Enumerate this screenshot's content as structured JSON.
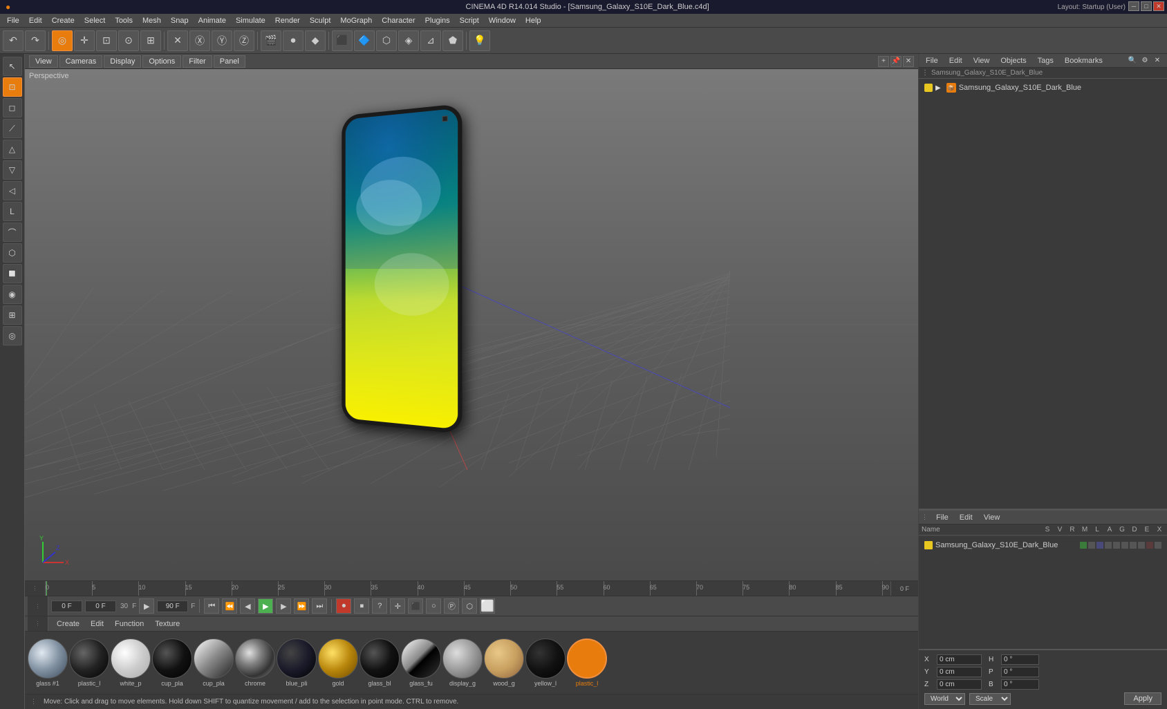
{
  "titleBar": {
    "icon": "●",
    "text": "CINEMA 4D R14.014 Studio - [Samsung_Galaxy_S10E_Dark_Blue.c4d]",
    "controls": [
      "─",
      "□",
      "✕"
    ]
  },
  "menuBar": {
    "items": [
      "File",
      "Edit",
      "Create",
      "Select",
      "Tools",
      "Mesh",
      "Snap",
      "Animate",
      "Simulate",
      "Render",
      "Sculpt",
      "MoGraph",
      "Character",
      "Plugins",
      "Script",
      "Window",
      "Help"
    ]
  },
  "viewport": {
    "tabs": [
      "View",
      "Cameras",
      "Display",
      "Options",
      "Filter",
      "Panel"
    ],
    "perspectiveLabel": "Perspective",
    "layoutLabel": "Layout: Startup (User)"
  },
  "rightPanel": {
    "topMenuItems": [
      "File",
      "Edit",
      "View",
      "Objects",
      "Tags",
      "Bookmarks"
    ],
    "objectTree": {
      "root": {
        "name": "Samsung_Galaxy_S10E_Dark_Blue",
        "icon": "📦",
        "dotColor": "#ccb800"
      }
    },
    "bottomMenuItems": [
      "File",
      "Edit",
      "View"
    ],
    "columnsHeader": [
      "Name",
      "S",
      "V",
      "R",
      "M",
      "L",
      "A",
      "G",
      "D",
      "E",
      "X"
    ],
    "sceneItems": [
      {
        "name": "Samsung_Galaxy_S10E_Dark_Blue",
        "iconType": "yellow"
      }
    ]
  },
  "timeline": {
    "startFrame": "0 F",
    "endFrame": "90 F",
    "currentFrame": "0 F",
    "nextFrame": "0 F",
    "ticks": [
      0,
      5,
      10,
      15,
      20,
      25,
      30,
      35,
      40,
      45,
      50,
      55,
      60,
      65,
      70,
      75,
      80,
      85,
      90
    ]
  },
  "transport": {
    "currentFrame": "0 F",
    "minFrame": "0 F",
    "maxFrame": "90 F",
    "fps": "30",
    "buttons": [
      "⏮",
      "⏪",
      "⏴",
      "▶",
      "⏵",
      "⏩",
      "⏭"
    ]
  },
  "materialPanel": {
    "menuItems": [
      "Create",
      "Edit",
      "Function",
      "Texture"
    ],
    "materials": [
      {
        "name": "glass #1",
        "type": "glass",
        "selected": false
      },
      {
        "name": "plastic_l",
        "type": "plastic-dark",
        "selected": false
      },
      {
        "name": "white_p",
        "type": "white",
        "selected": false
      },
      {
        "name": "cup_pla",
        "type": "plastic-dark2",
        "selected": false
      },
      {
        "name": "cup_pla",
        "type": "plastic-light",
        "selected": false
      },
      {
        "name": "chrome",
        "type": "chrome",
        "selected": false
      },
      {
        "name": "blue_pli",
        "type": "blue-dark",
        "selected": false
      },
      {
        "name": "gold",
        "type": "gold",
        "selected": false
      },
      {
        "name": "glass_bl",
        "type": "glass-black",
        "selected": false
      },
      {
        "name": "glass_fu",
        "type": "glass-half",
        "selected": false
      },
      {
        "name": "display_g",
        "type": "display",
        "selected": false
      },
      {
        "name": "wood_g",
        "type": "wood",
        "selected": false
      },
      {
        "name": "yellow_l",
        "type": "yellow",
        "selected": false
      },
      {
        "name": "plastic_l",
        "type": "plastic-orange",
        "selected": true
      }
    ]
  },
  "coordinatesPanel": {
    "rows": [
      {
        "axis": "X",
        "pos": "0 cm",
        "axis2": "H",
        "val2": "0 °"
      },
      {
        "axis": "Y",
        "pos": "0 cm",
        "axis2": "P",
        "val2": "0 °"
      },
      {
        "axis": "Z",
        "pos": "0 cm",
        "axis2": "B",
        "val2": "0 °"
      }
    ],
    "coordMode": "World",
    "transformMode": "Scale",
    "applyButton": "Apply"
  },
  "statusBar": {
    "text": "Move: Click and drag to move elements. Hold down SHIFT to quantize movement / add to the selection in point mode. CTRL to remove."
  },
  "icons": {
    "undo": "↶",
    "redo": "↷",
    "move": "✛",
    "scale": "⊠",
    "rotate": "⊙",
    "play": "▶",
    "pause": "⏸",
    "stop": "⏹",
    "rewind": "⏮",
    "forward": "⏭"
  }
}
